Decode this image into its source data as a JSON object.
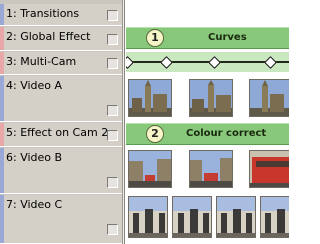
{
  "tracks": [
    {
      "number": "1",
      "name": "Transitions",
      "color": "#9aa8d8"
    },
    {
      "number": "2",
      "name": "Global Effect",
      "color": "#e9a7a7"
    },
    {
      "number": "3",
      "name": "Multi-Cam",
      "color": "#e9a7a7"
    },
    {
      "number": "4",
      "name": "Video A",
      "color": "#9aa8d8"
    },
    {
      "number": "5",
      "name": "Effect on Cam 2",
      "color": "#e9a7a7"
    },
    {
      "number": "6",
      "name": "Video B",
      "color": "#9aa8d8"
    },
    {
      "number": "7",
      "name": "Video C",
      "color": "#9aa8d8"
    }
  ],
  "effects": [
    {
      "badge": "1",
      "title": "Curves",
      "color": "#88c87a"
    },
    {
      "badge": "2",
      "title": "Colour correct",
      "color": "#88c87a"
    }
  ],
  "clips": {
    "video_a": [
      "big-ben-thumbnail",
      "big-ben-thumbnail",
      "big-ben-thumbnail"
    ],
    "video_b": [
      "street-scene-thumbnail",
      "street-scene-thumbnail",
      "red-bus-thumbnail"
    ],
    "video_c": [
      "palace-gate-thumbnail",
      "palace-gate-thumbnail",
      "palace-gate-thumbnail",
      "palace-gate-thumbnail"
    ]
  }
}
